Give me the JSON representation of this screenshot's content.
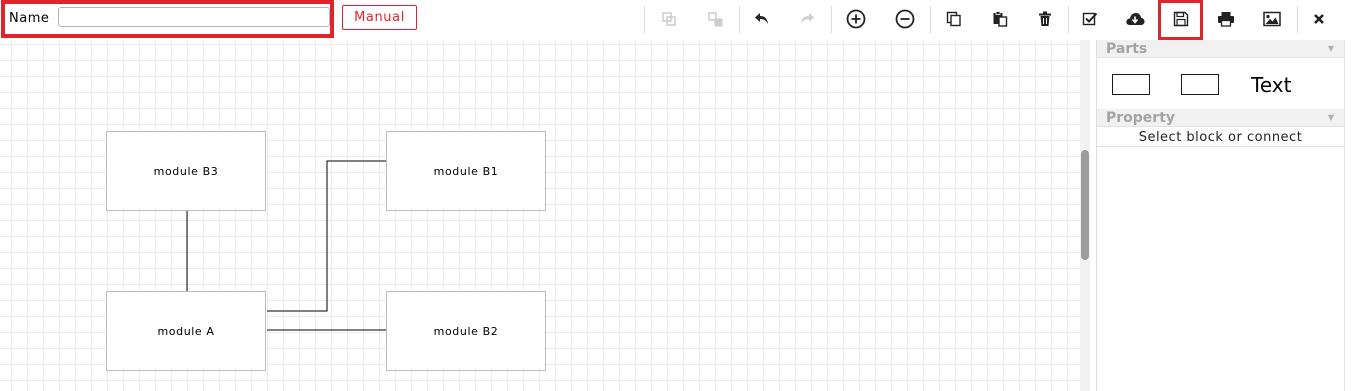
{
  "header": {
    "name_label": "Name",
    "name_value": "",
    "manual_label": "Manual"
  },
  "toolbar": {
    "buttons": [
      {
        "icon": "group-icon",
        "enabled": false
      },
      {
        "icon": "ungroup-icon",
        "enabled": false
      },
      {
        "icon": "undo-icon",
        "enabled": true
      },
      {
        "icon": "redo-icon",
        "enabled": false
      },
      {
        "icon": "zoom-in-icon",
        "enabled": true
      },
      {
        "icon": "zoom-out-icon",
        "enabled": true
      },
      {
        "icon": "copy-icon",
        "enabled": true
      },
      {
        "icon": "paste-icon",
        "enabled": true
      },
      {
        "icon": "delete-icon",
        "enabled": true
      },
      {
        "icon": "validate-icon",
        "enabled": true
      },
      {
        "icon": "cloud-download-icon",
        "enabled": true
      },
      {
        "icon": "save-icon",
        "enabled": true,
        "highlighted": true
      },
      {
        "icon": "print-icon",
        "enabled": true
      },
      {
        "icon": "image-icon",
        "enabled": true
      },
      {
        "icon": "close-icon",
        "enabled": true
      }
    ]
  },
  "diagram": {
    "blocks": [
      {
        "id": "b3",
        "label": "module B3"
      },
      {
        "id": "b1",
        "label": "module B1"
      },
      {
        "id": "a",
        "label": "module A"
      },
      {
        "id": "b2",
        "label": "module B2"
      }
    ],
    "connections": [
      {
        "from": "b3",
        "to": "a"
      },
      {
        "from": "a",
        "to": "b1"
      },
      {
        "from": "a",
        "to": "b2"
      }
    ]
  },
  "panel": {
    "parts_title": "Parts",
    "parts_text_label": "Text",
    "property_title": "Property",
    "property_placeholder": "Select block or connect"
  },
  "colors": {
    "highlight": "#e0242c",
    "icon_enabled": "#222222",
    "icon_disabled": "#cccccc"
  }
}
